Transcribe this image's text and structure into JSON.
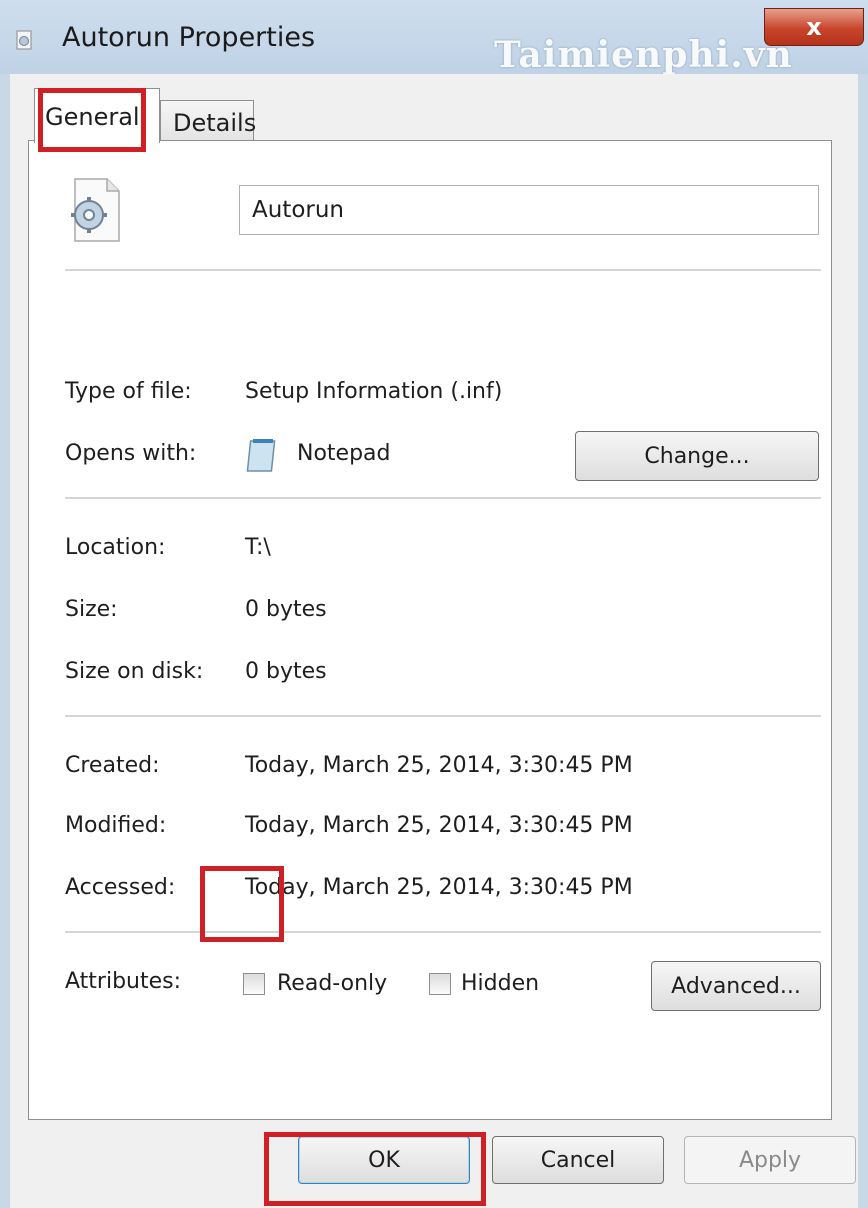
{
  "window": {
    "title": "Autorun Properties",
    "close_label": "x",
    "watermark": "Taimienphi.vn"
  },
  "tabs": [
    {
      "label": "General",
      "active": true
    },
    {
      "label": "Details",
      "active": false
    }
  ],
  "general": {
    "file_name": "Autorun",
    "file_icon": "inf-settings-file-icon",
    "type_label": "Type of file:",
    "type_value": "Setup Information (.inf)",
    "opens_label": "Opens with:",
    "opens_value": "Notepad",
    "opens_icon": "notepad-icon",
    "change_button": "Change...",
    "location_label": "Location:",
    "location_value": "T:\\",
    "size_label": "Size:",
    "size_value": "0 bytes",
    "size_disk_label": "Size on disk:",
    "size_disk_value": "0 bytes",
    "created_label": "Created:",
    "created_value": "Today, March 25, 2014, 3:30:45 PM",
    "modified_label": "Modified:",
    "modified_value": "Today, March 25, 2014, 3:30:45 PM",
    "accessed_label": "Accessed:",
    "accessed_value": "Today, March 25, 2014, 3:30:45 PM",
    "attributes_label": "Attributes:",
    "readonly_label": "Read-only",
    "readonly_checked": false,
    "hidden_label": "Hidden",
    "hidden_checked": false,
    "advanced_button": "Advanced..."
  },
  "footer": {
    "ok": "OK",
    "cancel": "Cancel",
    "apply": "Apply",
    "apply_enabled": false
  },
  "colors": {
    "highlight": "#d01f25",
    "titlebar": "#c9d8e6"
  }
}
